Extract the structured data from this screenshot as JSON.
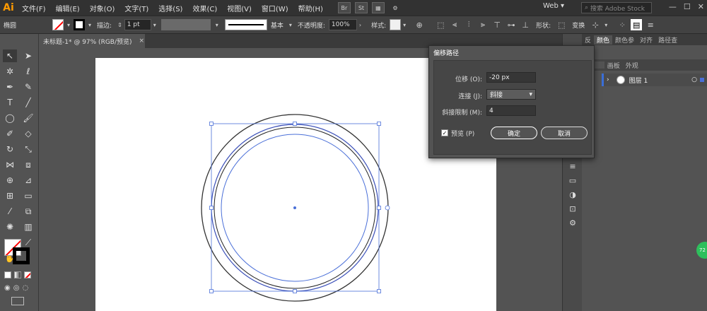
{
  "app": {
    "logo": "Ai"
  },
  "menu": [
    "文件(F)",
    "编辑(E)",
    "对象(O)",
    "文字(T)",
    "选择(S)",
    "效果(C)",
    "视图(V)",
    "窗口(W)",
    "帮助(H)"
  ],
  "menubar_icons": [
    "Br",
    "St"
  ],
  "workspace": "Web",
  "search_placeholder": "搜索 Adobe Stock",
  "control": {
    "object_label": "椭圆",
    "stroke_label": "描边:",
    "stroke_weight": "1 pt",
    "stroke_style": "基本",
    "opacity_label": "不透明度:",
    "opacity_value": "100%",
    "style_label": "样式:",
    "shape_label": "形状:",
    "transform_label": "变换"
  },
  "document_tab": {
    "title": "未标题-1* @ 97% (RGB/预览)",
    "close": "×"
  },
  "panels": {
    "top_tabs": [
      "颜色",
      "颜色参",
      "对齐",
      "路径查"
    ],
    "sub_tabs": [
      "画板",
      "外观"
    ],
    "layer_name": "图层 1"
  },
  "dialog": {
    "title": "偏移路径",
    "offset_label": "位移 (O):",
    "offset_value": "-20 px",
    "join_label": "连接 (J):",
    "join_value": "斜接",
    "miter_label": "斜接限制 (M):",
    "miter_value": "4",
    "preview_label": "预览 (P)",
    "preview_checked": true,
    "ok_label": "确定",
    "cancel_label": "取消"
  },
  "badge_text": "72",
  "colors": {
    "selection": "#4a6fd8",
    "accent": "#ff9a00"
  }
}
